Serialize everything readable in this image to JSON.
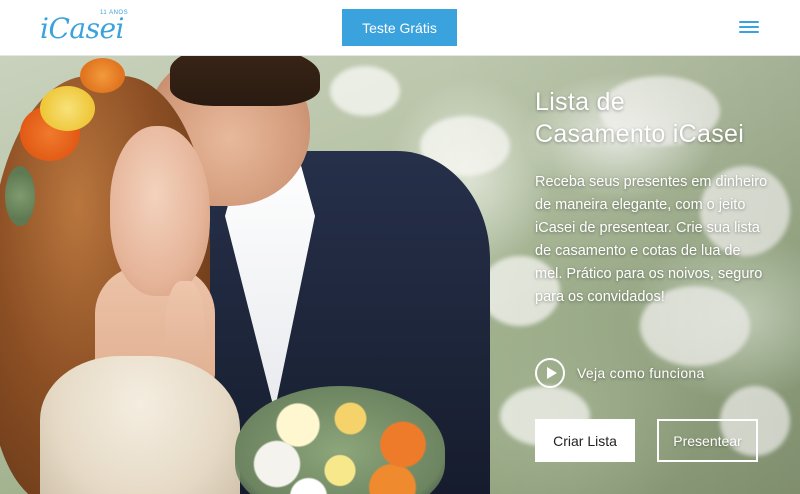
{
  "header": {
    "logo_text": "iCasei",
    "logo_badge": "11 ANOS",
    "cta_label": "Teste Grátis",
    "menu_icon": "hamburger-menu-icon"
  },
  "hero": {
    "title_line1": "Lista de",
    "title_line2": "Casamento iCasei",
    "description": "Receba seus presentes em dinheiro de maneira elegante, com o jeito iCasei de presentear. Crie sua lista de casamento e cotas de lua de mel. Prático para os noivos, seguro para os convidados!",
    "video_label": "Veja como funciona",
    "video_icon": "play-circle-icon",
    "primary_button": "Criar Lista",
    "secondary_button": "Presentear"
  },
  "colors": {
    "brand": "#3aa2dc",
    "white": "#ffffff",
    "button_text": "#222222"
  }
}
